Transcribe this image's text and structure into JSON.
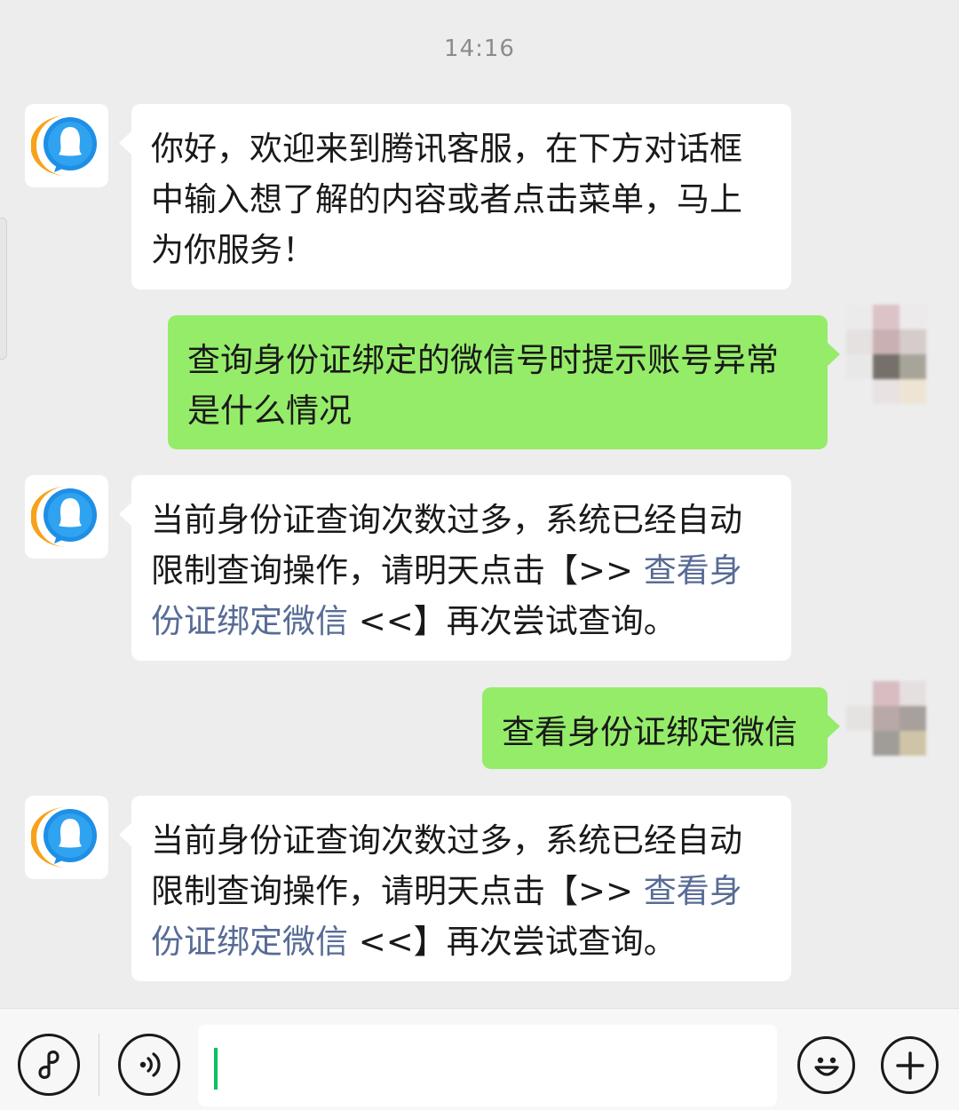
{
  "chat": {
    "timestamp": "14:16",
    "messages": [
      {
        "from": "service",
        "parts": [
          {
            "text": "你好，欢迎来到腾讯客服，在下方对话框中输入想了解的内容或者点击菜单，马上为你服务！"
          }
        ]
      },
      {
        "from": "user",
        "parts": [
          {
            "text": "查询身份证绑定的微信号时提示账号异常是什么情况"
          }
        ]
      },
      {
        "from": "service",
        "parts": [
          {
            "text": "当前身份证查询次数过多，系统已经自动限制查询操作，请明天点击【>> "
          },
          {
            "text": "查看身份证绑定微信",
            "link": true
          },
          {
            "text": " <<】再次尝试查询。"
          }
        ]
      },
      {
        "from": "user",
        "parts": [
          {
            "text": "查看身份证绑定微信"
          }
        ]
      },
      {
        "from": "service",
        "parts": [
          {
            "text": "当前身份证查询次数过多，系统已经自动限制查询操作，请明天点击【>> "
          },
          {
            "text": "查看身份证绑定微信",
            "link": true
          },
          {
            "text": " <<】再次尝试查询。"
          }
        ]
      }
    ]
  },
  "input_bar": {
    "mini_program_icon": "mini-program-icon",
    "voice_icon": "voice-icon",
    "input_value": "",
    "emoji_icon": "emoji-icon",
    "more_icon": "plus-icon"
  },
  "colors": {
    "background": "#ededed",
    "incoming_bubble": "#ffffff",
    "outgoing_bubble": "#95ec69",
    "link": "#576b95",
    "caret": "#07c160"
  }
}
